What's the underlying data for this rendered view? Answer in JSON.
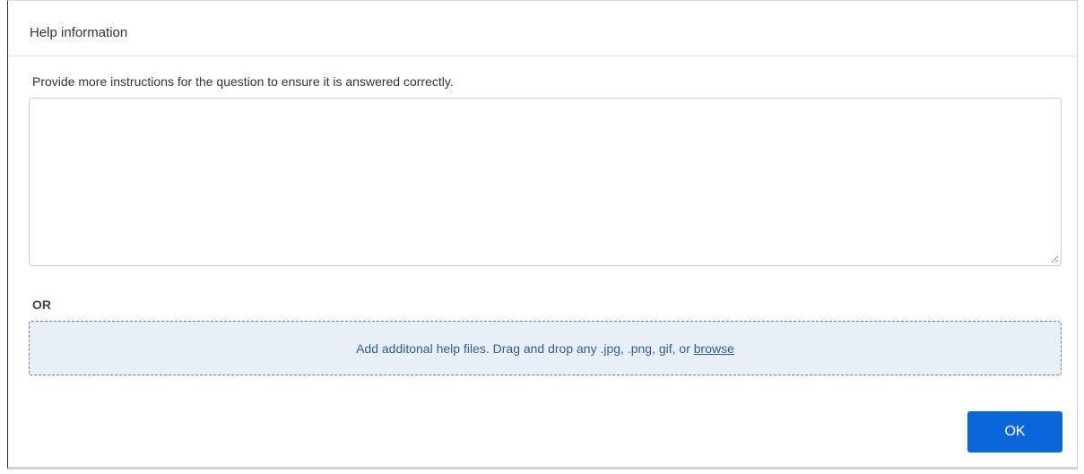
{
  "dialog": {
    "title": "Help information",
    "instructions": "Provide more instructions for the question to ensure it is answered correctly.",
    "textarea_value": "",
    "or_label": "OR",
    "dropzone": {
      "text": "Add additonal help files. Drag and drop any .jpg, .png, gif, or ",
      "browse_label": "browse"
    },
    "ok_label": "OK"
  },
  "colors": {
    "primary_button": "#0a66d9",
    "dropzone_bg": "#e8eff5",
    "dropzone_border": "#5a7fb6",
    "link": "#2f5e99"
  },
  "icons": {
    "resize_handle": "resize-grip-icon"
  }
}
